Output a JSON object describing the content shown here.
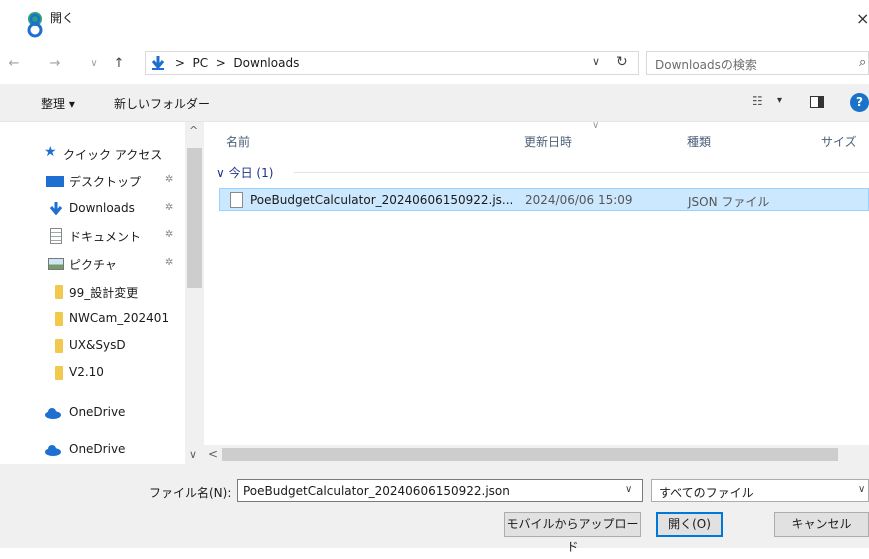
{
  "window": {
    "title": "開く",
    "close_glyph": "×"
  },
  "nav": {
    "back_glyph": "←",
    "forward_glyph": "→",
    "recent_glyph": "∨",
    "up_glyph": "↑",
    "address_path": " >  PC  >  Downloads",
    "address_dropdown": "∨",
    "refresh_glyph": "↻",
    "search_placeholder": "Downloadsの検索",
    "search_glyph": "⌕"
  },
  "toolbar": {
    "organize": "整理 ▾",
    "new_folder": "新しいフォルダー",
    "view_glyph": "☷",
    "view_dd": "▾",
    "help": "?"
  },
  "sidebar": {
    "items": [
      {
        "label": "クイック アクセス",
        "icon": "star-icon",
        "pinned": false
      },
      {
        "label": "デスクトップ",
        "icon": "desktop-icon",
        "pinned": true
      },
      {
        "label": "Downloads",
        "icon": "download-icon",
        "pinned": true
      },
      {
        "label": "ドキュメント",
        "icon": "document-icon",
        "pinned": true
      },
      {
        "label": "ピクチャ",
        "icon": "picture-icon",
        "pinned": true
      },
      {
        "label": "99_設計変更",
        "icon": "folder-icon",
        "pinned": false
      },
      {
        "label": "NWCam_202401",
        "icon": "folder-icon",
        "pinned": false
      },
      {
        "label": "UX&SysD",
        "icon": "folder-icon",
        "pinned": false
      },
      {
        "label": "V2.10",
        "icon": "folder-icon",
        "pinned": false
      },
      {
        "label": "OneDrive",
        "icon": "onedrive-icon",
        "pinned": false
      },
      {
        "label": "OneDrive",
        "icon": "onedrive-icon",
        "pinned": false
      }
    ],
    "pin_glyph": "✲",
    "scroll_up": "^",
    "scroll_down": "∨"
  },
  "filelist": {
    "columns": [
      "名前",
      "更新日時",
      "種類",
      "サイズ"
    ],
    "sort_glyph": "∨",
    "group": "∨ 今日 (1)",
    "files": [
      {
        "name": "PoeBudgetCalculator_20240606150922.js...",
        "modified": "2024/06/06 15:09",
        "type": "JSON ファイル"
      }
    ],
    "hscroll_left": "<"
  },
  "footer": {
    "filename_label": "ファイル名(N):",
    "filename_value": "PoeBudgetCalculator_20240606150922.json",
    "filetype_value": "すべてのファイル",
    "dd_glyph": "∨",
    "upload_button": "モバイルからアップロード",
    "open_button": "開く(O)",
    "cancel_button": "キャンセル"
  },
  "colors": {
    "selection": "#cce8ff",
    "accent": "#0078d7"
  }
}
